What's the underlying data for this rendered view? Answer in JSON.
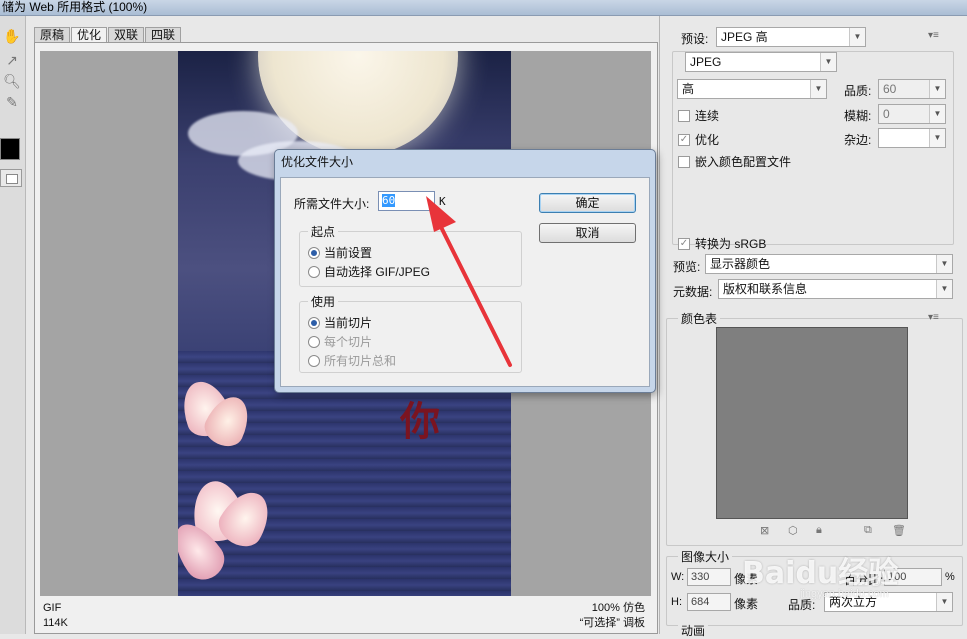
{
  "window": {
    "title": "储为 Web 所用格式 (100%)"
  },
  "tabs": [
    {
      "label": "原稿"
    },
    {
      "label": "优化"
    },
    {
      "label": "双联"
    },
    {
      "label": "四联"
    }
  ],
  "status": {
    "format": "GIF",
    "size": "114K",
    "zoom": "100% 仿色",
    "selectable": "“可选择” 调板"
  },
  "image": {
    "character": "你"
  },
  "dialog": {
    "title": "优化文件大小",
    "size_label": "所需文件大小:",
    "size_value": "60",
    "size_unit": "K",
    "ok_label": "确定",
    "cancel_label": "取消",
    "start_group": {
      "title": "起点",
      "options": [
        "当前设置",
        "自动选择 GIF/JPEG"
      ],
      "selected": "当前设置"
    },
    "use_group": {
      "title": "使用",
      "options": [
        "当前切片",
        "每个切片",
        "所有切片总和"
      ],
      "selected": "当前切片"
    }
  },
  "arrow_color": "#e8343a",
  "settings": {
    "preset_label": "预设:",
    "preset_value": "JPEG 高",
    "format_value": "JPEG",
    "quality_level": "高",
    "quality_label": "品质:",
    "quality_value": "60",
    "progressive_label": "连续",
    "blur_label": "模糊:",
    "blur_value": "0",
    "optimized_label": "优化",
    "matte_label": "杂边:",
    "embed_profile_label": "嵌入颜色配置文件",
    "srgb_label": "转换为 sRGB",
    "preview_label": "预览:",
    "preview_value": "显示器颜色",
    "metadata_label": "元数据:",
    "metadata_value": "版权和联系信息"
  },
  "color_table": {
    "title": "颜色表",
    "swatch": "#7f7f7f"
  },
  "image_size": {
    "title": "图像大小",
    "w_label": "W:",
    "w_value": "330",
    "h_label": "H:",
    "h_value": "684",
    "pixel_unit": "像素",
    "percent_label": "百分比:",
    "percent_value": "100",
    "percent_unit": "%",
    "quality_label": "品质:",
    "quality_value": "两次立方"
  },
  "animation": {
    "title": "动画"
  },
  "watermark": {
    "text": "Baidu经验",
    "sub": "jingyan.baidu.com"
  }
}
